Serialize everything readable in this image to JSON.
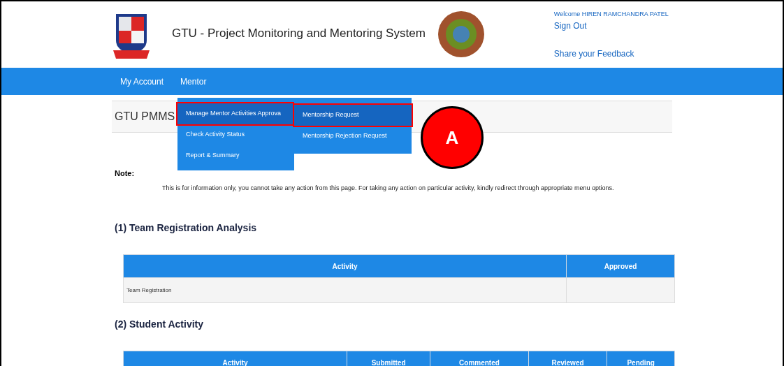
{
  "header": {
    "title": "GTU - Project Monitoring and Mentoring System",
    "welcome": "Welcome HIREN RAMCHANDRA PATEL",
    "sign_out": "Sign Out",
    "feedback": "Share your Feedback"
  },
  "nav": {
    "items": [
      {
        "label": "My Account"
      },
      {
        "label": "Mentor"
      }
    ]
  },
  "menu": {
    "items": [
      {
        "label": "Manage Mentor Activities Approva",
        "selected": true,
        "highlighted": true
      },
      {
        "label": "Check Activity Status",
        "selected": false,
        "highlighted": false
      },
      {
        "label": "Report & Summary",
        "selected": false,
        "highlighted": false
      }
    ],
    "submenu": [
      {
        "label": "Mentorship Request",
        "selected": true,
        "highlighted": true
      },
      {
        "label": "Mentorship Rejection Request",
        "selected": false,
        "highlighted": false
      }
    ]
  },
  "callout": "A",
  "page_title": "GTU PMMS",
  "note": {
    "heading": "Note:",
    "text": "This is for information only, you cannot take any action from this page. For taking any action on particular activity, kindly redirect through appropriate menu options."
  },
  "sections": [
    {
      "heading": "(1) Team Registration Analysis",
      "columns": [
        "Activity",
        "Approved"
      ],
      "rows": [
        [
          "Team Registration",
          ""
        ]
      ]
    },
    {
      "heading": "(2) Student Activity",
      "columns": [
        "Activity",
        "Submitted",
        "Commented",
        "Reviewed",
        "Pending"
      ]
    }
  ]
}
